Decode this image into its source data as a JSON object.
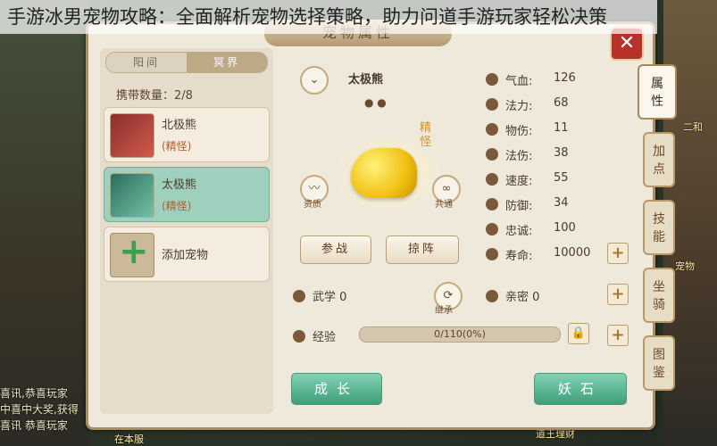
{
  "caption": "手游冰男宠物攻略：全面解析宠物选择策略，助力问道手游玩家轻松决策",
  "panel": {
    "title": "宠物属性",
    "close_icon": "✕"
  },
  "left": {
    "segments": [
      "阳间",
      "冥界"
    ],
    "active_segment": 1,
    "carry_label": "携带数量：",
    "carry_value": "2/8",
    "pets": [
      {
        "name": "北极熊",
        "type": "(精怪)",
        "selected": false,
        "avatar_color": "#d05a4a"
      },
      {
        "name": "太极熊",
        "type": "(精怪)",
        "selected": true,
        "avatar_color": "#76c1a6"
      }
    ],
    "add_label": "添加宠物"
  },
  "center": {
    "pet_name": "太极熊",
    "rank_tag": "精怪",
    "talent_label": "资质",
    "share_label": "共通",
    "btn_battle": "参战",
    "btn_formation": "掠阵",
    "martial_label": "武学 0",
    "inherit_label": "继承",
    "exp_label": "经验",
    "exp_text": "0/110(0%)",
    "exp_fraction": 0.0
  },
  "stats": [
    {
      "k": "气血:",
      "v": "126"
    },
    {
      "k": "法力:",
      "v": "68"
    },
    {
      "k": "物伤:",
      "v": "11"
    },
    {
      "k": "法伤:",
      "v": "38"
    },
    {
      "k": "速度:",
      "v": "55"
    },
    {
      "k": "防御:",
      "v": "34"
    },
    {
      "k": "忠诚:",
      "v": "100"
    },
    {
      "k": "寿命:",
      "v": "10000"
    }
  ],
  "intimacy_label": "亲密 0",
  "bottom": {
    "grow": "成长",
    "yaoshi": "妖石"
  },
  "tabs": [
    {
      "label": "属性",
      "active": true
    },
    {
      "label": "加点",
      "active": false
    },
    {
      "label": "技能",
      "active": false
    },
    {
      "label": "坐骑",
      "active": false
    },
    {
      "label": "图鉴",
      "active": false
    }
  ],
  "background": {
    "chat_lines": [
      "喜讯,恭喜玩家",
      "中喜中大奖,获得",
      "喜讯 恭喜玩家"
    ],
    "right_labels": [
      "二和",
      "宠物",
      "道王理财"
    ],
    "left_bottom": "在本服"
  }
}
